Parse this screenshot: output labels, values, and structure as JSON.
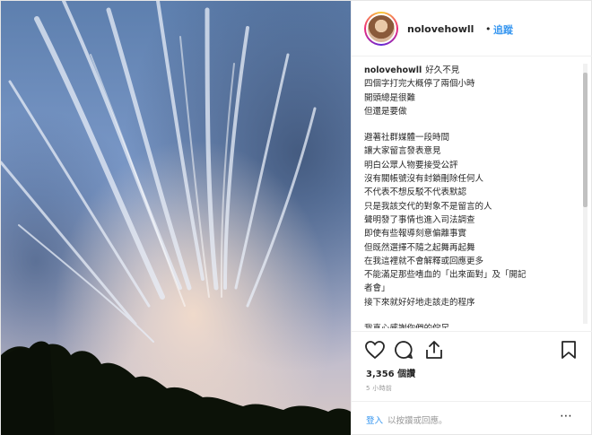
{
  "post": {
    "username": "nolovehowll",
    "separator": "•",
    "follow_label": "追蹤",
    "caption_user": "nolovehowll",
    "caption_lines": [
      "好久不見",
      "四個字打完大概停了兩個小時",
      "開頭總是很難",
      "但還是要做",
      "",
      "避著社群媒體一段時間",
      "讓大家留言發表意見",
      "明白公眾人物要接受公評",
      "沒有關帳號沒有封鎖刪除任何人",
      "不代表不想反駁不代表默認",
      "只是我該交代的對象不是留言的人",
      "聲明發了事情也進入司法調查",
      "即使有些報導刻意偏離事實",
      "但既然選擇不隨之起舞再起舞",
      "在我這裡就不會解釋或回應更多",
      "不能滿足那些嗜血的「出來面對」及「開記",
      "者會」",
      "接下來就好好地走該走的程序",
      "",
      "我真心感謝你們的佇足"
    ],
    "likes": "3,356 個讚",
    "time_ago": "5 小時前",
    "comment_login": "登入",
    "comment_prompt": "以按讚或回應。",
    "more_icon": "⋯"
  },
  "icons": {
    "like": "heart-icon",
    "comment": "comment-icon",
    "share": "share-icon",
    "save": "bookmark-icon",
    "more": "more-options-icon"
  },
  "colors": {
    "link": "#3897f0",
    "text": "#262626",
    "muted": "#999999",
    "sky": "#6f8fb8"
  }
}
